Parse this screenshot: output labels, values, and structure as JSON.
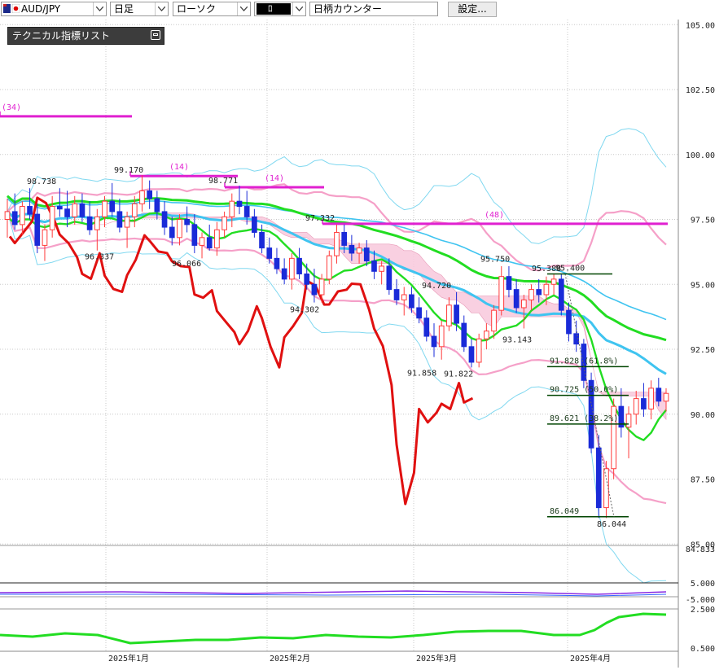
{
  "toolbar": {
    "symbol": "AUD/JPY",
    "timeframe": "日足",
    "chart_type": "ローソク",
    "drawing_tool": "ﾛ",
    "counter_label": "日柄カウンター",
    "settings_label": "設定..."
  },
  "indicator_panel": {
    "title": "テクニカル指標リスト"
  },
  "colors": {
    "bull_candle": "#ff3b3b",
    "bear_candle": "#1a2bd8",
    "moving_avg_short": "#3fc4f0",
    "moving_avg_long": "#22dd22",
    "bollinger": "#f5a0c8",
    "bollinger_outer": "#80d8f0",
    "ichimoku_cloud": "#f8c8dc",
    "lagging_line": "#e01010",
    "high_low_line": "#e020d0",
    "fibonacci_line": "#004400"
  },
  "chart_data": {
    "type": "candlestick",
    "yaxis_ticks": [
      "105.00",
      "102.50",
      "100.00",
      "97.50",
      "95.00",
      "92.50",
      "90.00",
      "87.50",
      "85.00",
      "84.833"
    ],
    "subpanel_ticks": [
      "5.000",
      "-5.000",
      "2.500",
      "0.500"
    ],
    "xaxis_ticks": [
      "2025年1月",
      "2025年2月",
      "2025年3月",
      "2025年4月"
    ],
    "price_labels": [
      "98.738",
      "96.337",
      "99.170",
      "96.066",
      "98.771",
      "94.302",
      "97.332",
      "91.858",
      "91.822",
      "94.720",
      "95.750",
      "93.143",
      "95.388",
      "95.400",
      "86.049",
      "86.044"
    ],
    "period_labels": [
      "(34)",
      "(14)",
      "(14)",
      "(48)"
    ],
    "fibonacci_levels": [
      {
        "price": 91.828,
        "label": "91.828 (61.8%)"
      },
      {
        "price": 90.725,
        "label": "90.725 (50.0%)"
      },
      {
        "price": 89.621,
        "label": "89.621 (38.2%)"
      },
      {
        "price": 86.049,
        "label": "86.049"
      }
    ],
    "horizontal_lines": [
      {
        "price": 101.47,
        "label": "(34)"
      },
      {
        "price": 99.17,
        "label": "(14)"
      },
      {
        "price": 98.74,
        "label": "(14)"
      },
      {
        "price": 97.33,
        "label": "(48)"
      }
    ],
    "candles": [
      {
        "o": 97.5,
        "h": 98.3,
        "l": 96.8,
        "c": 97.8
      },
      {
        "o": 97.8,
        "h": 98.5,
        "l": 97.1,
        "c": 97.3
      },
      {
        "o": 97.3,
        "h": 98.2,
        "l": 96.9,
        "c": 98.0
      },
      {
        "o": 98.0,
        "h": 98.7,
        "l": 97.5,
        "c": 97.7
      },
      {
        "o": 97.7,
        "h": 98.1,
        "l": 96.2,
        "c": 96.5
      },
      {
        "o": 96.5,
        "h": 97.3,
        "l": 95.9,
        "c": 97.1
      },
      {
        "o": 97.1,
        "h": 98.4,
        "l": 96.8,
        "c": 98.0
      },
      {
        "o": 98.0,
        "h": 98.7,
        "l": 97.6,
        "c": 97.9
      },
      {
        "o": 97.9,
        "h": 98.6,
        "l": 97.2,
        "c": 97.6
      },
      {
        "o": 97.6,
        "h": 98.4,
        "l": 97.3,
        "c": 98.1
      },
      {
        "o": 98.1,
        "h": 98.5,
        "l": 97.4,
        "c": 97.6
      },
      {
        "o": 97.6,
        "h": 98.2,
        "l": 96.9,
        "c": 97.1
      },
      {
        "o": 97.1,
        "h": 97.9,
        "l": 96.3,
        "c": 97.6
      },
      {
        "o": 97.6,
        "h": 98.4,
        "l": 97.2,
        "c": 98.2
      },
      {
        "o": 98.2,
        "h": 98.9,
        "l": 97.6,
        "c": 97.8
      },
      {
        "o": 97.8,
        "h": 98.3,
        "l": 97.0,
        "c": 97.2
      },
      {
        "o": 97.2,
        "h": 97.8,
        "l": 96.4,
        "c": 97.6
      },
      {
        "o": 97.6,
        "h": 98.4,
        "l": 97.2,
        "c": 98.1
      },
      {
        "o": 98.1,
        "h": 99.2,
        "l": 97.8,
        "c": 98.6
      },
      {
        "o": 98.6,
        "h": 99.0,
        "l": 97.9,
        "c": 98.3
      },
      {
        "o": 98.3,
        "h": 98.6,
        "l": 97.5,
        "c": 97.8
      },
      {
        "o": 97.8,
        "h": 98.2,
        "l": 96.9,
        "c": 97.2
      },
      {
        "o": 97.2,
        "h": 97.6,
        "l": 96.5,
        "c": 96.8
      },
      {
        "o": 96.8,
        "h": 97.7,
        "l": 96.5,
        "c": 97.5
      },
      {
        "o": 97.5,
        "h": 98.0,
        "l": 97.0,
        "c": 97.3
      },
      {
        "o": 97.3,
        "h": 97.7,
        "l": 96.2,
        "c": 96.5
      },
      {
        "o": 96.5,
        "h": 97.0,
        "l": 96.0,
        "c": 96.8
      },
      {
        "o": 96.8,
        "h": 97.3,
        "l": 96.3,
        "c": 96.4
      },
      {
        "o": 96.4,
        "h": 97.4,
        "l": 96.1,
        "c": 97.1
      },
      {
        "o": 97.1,
        "h": 97.8,
        "l": 96.8,
        "c": 97.6
      },
      {
        "o": 97.6,
        "h": 98.5,
        "l": 97.2,
        "c": 98.2
      },
      {
        "o": 98.2,
        "h": 98.8,
        "l": 97.7,
        "c": 98.0
      },
      {
        "o": 98.0,
        "h": 98.6,
        "l": 97.3,
        "c": 97.6
      },
      {
        "o": 97.6,
        "h": 97.9,
        "l": 96.8,
        "c": 97.0
      },
      {
        "o": 97.0,
        "h": 97.3,
        "l": 96.2,
        "c": 96.4
      },
      {
        "o": 96.4,
        "h": 96.8,
        "l": 95.8,
        "c": 96.0
      },
      {
        "o": 96.0,
        "h": 96.4,
        "l": 95.4,
        "c": 95.6
      },
      {
        "o": 95.6,
        "h": 96.0,
        "l": 95.0,
        "c": 95.2
      },
      {
        "o": 95.2,
        "h": 96.2,
        "l": 94.8,
        "c": 96.0
      },
      {
        "o": 96.0,
        "h": 96.4,
        "l": 95.2,
        "c": 95.4
      },
      {
        "o": 95.4,
        "h": 95.8,
        "l": 94.8,
        "c": 95.0
      },
      {
        "o": 95.0,
        "h": 95.6,
        "l": 94.3,
        "c": 94.6
      },
      {
        "o": 94.6,
        "h": 95.4,
        "l": 94.3,
        "c": 95.2
      },
      {
        "o": 95.2,
        "h": 96.3,
        "l": 95.0,
        "c": 96.1
      },
      {
        "o": 96.1,
        "h": 97.3,
        "l": 95.8,
        "c": 97.0
      },
      {
        "o": 97.0,
        "h": 97.3,
        "l": 96.2,
        "c": 96.5
      },
      {
        "o": 96.5,
        "h": 96.9,
        "l": 95.9,
        "c": 96.2
      },
      {
        "o": 96.2,
        "h": 96.6,
        "l": 95.8,
        "c": 96.4
      },
      {
        "o": 96.4,
        "h": 96.7,
        "l": 95.7,
        "c": 95.9
      },
      {
        "o": 95.9,
        "h": 96.3,
        "l": 95.2,
        "c": 95.5
      },
      {
        "o": 95.5,
        "h": 95.9,
        "l": 95.0,
        "c": 95.7
      },
      {
        "o": 95.7,
        "h": 96.0,
        "l": 94.6,
        "c": 94.8
      },
      {
        "o": 94.8,
        "h": 95.2,
        "l": 94.2,
        "c": 94.4
      },
      {
        "o": 94.4,
        "h": 94.9,
        "l": 93.8,
        "c": 94.6
      },
      {
        "o": 94.6,
        "h": 94.9,
        "l": 93.9,
        "c": 94.1
      },
      {
        "o": 94.1,
        "h": 94.5,
        "l": 93.5,
        "c": 93.7
      },
      {
        "o": 93.7,
        "h": 94.0,
        "l": 92.8,
        "c": 93.0
      },
      {
        "o": 93.0,
        "h": 93.5,
        "l": 92.2,
        "c": 92.6
      },
      {
        "o": 92.6,
        "h": 93.6,
        "l": 92.1,
        "c": 93.4
      },
      {
        "o": 93.4,
        "h": 94.5,
        "l": 93.2,
        "c": 94.2
      },
      {
        "o": 94.2,
        "h": 94.7,
        "l": 93.2,
        "c": 93.5
      },
      {
        "o": 93.5,
        "h": 93.8,
        "l": 92.4,
        "c": 92.6
      },
      {
        "o": 92.6,
        "h": 92.9,
        "l": 91.8,
        "c": 92.0
      },
      {
        "o": 92.0,
        "h": 93.1,
        "l": 91.8,
        "c": 92.9
      },
      {
        "o": 92.9,
        "h": 93.5,
        "l": 92.5,
        "c": 93.2
      },
      {
        "o": 93.2,
        "h": 94.2,
        "l": 92.9,
        "c": 94.0
      },
      {
        "o": 94.0,
        "h": 95.7,
        "l": 93.8,
        "c": 95.3
      },
      {
        "o": 95.3,
        "h": 95.7,
        "l": 94.5,
        "c": 94.8
      },
      {
        "o": 94.8,
        "h": 95.2,
        "l": 93.9,
        "c": 94.1
      },
      {
        "o": 94.1,
        "h": 94.6,
        "l": 93.3,
        "c": 94.4
      },
      {
        "o": 94.4,
        "h": 95.0,
        "l": 94.0,
        "c": 94.8
      },
      {
        "o": 94.8,
        "h": 95.2,
        "l": 94.3,
        "c": 94.6
      },
      {
        "o": 94.6,
        "h": 95.3,
        "l": 94.2,
        "c": 95.0
      },
      {
        "o": 95.0,
        "h": 95.4,
        "l": 94.6,
        "c": 95.2
      },
      {
        "o": 95.2,
        "h": 95.4,
        "l": 93.8,
        "c": 94.0
      },
      {
        "o": 94.0,
        "h": 94.3,
        "l": 92.8,
        "c": 93.1
      },
      {
        "o": 93.1,
        "h": 93.6,
        "l": 92.4,
        "c": 92.7
      },
      {
        "o": 92.7,
        "h": 92.9,
        "l": 91.0,
        "c": 91.3
      },
      {
        "o": 91.3,
        "h": 91.6,
        "l": 88.5,
        "c": 88.7
      },
      {
        "o": 88.7,
        "h": 89.2,
        "l": 86.0,
        "c": 86.4
      },
      {
        "o": 86.4,
        "h": 88.2,
        "l": 86.0,
        "c": 87.9
      },
      {
        "o": 87.9,
        "h": 90.6,
        "l": 87.5,
        "c": 90.3
      },
      {
        "o": 90.3,
        "h": 91.0,
        "l": 89.1,
        "c": 89.5
      },
      {
        "o": 89.5,
        "h": 90.3,
        "l": 88.3,
        "c": 90.0
      },
      {
        "o": 90.0,
        "h": 90.9,
        "l": 89.6,
        "c": 90.6
      },
      {
        "o": 90.6,
        "h": 91.2,
        "l": 89.9,
        "c": 90.2
      },
      {
        "o": 90.2,
        "h": 91.3,
        "l": 89.8,
        "c": 91.0
      },
      {
        "o": 91.0,
        "h": 91.4,
        "l": 90.3,
        "c": 90.5
      },
      {
        "o": 90.5,
        "h": 91.0,
        "l": 90.1,
        "c": 90.8
      }
    ]
  }
}
